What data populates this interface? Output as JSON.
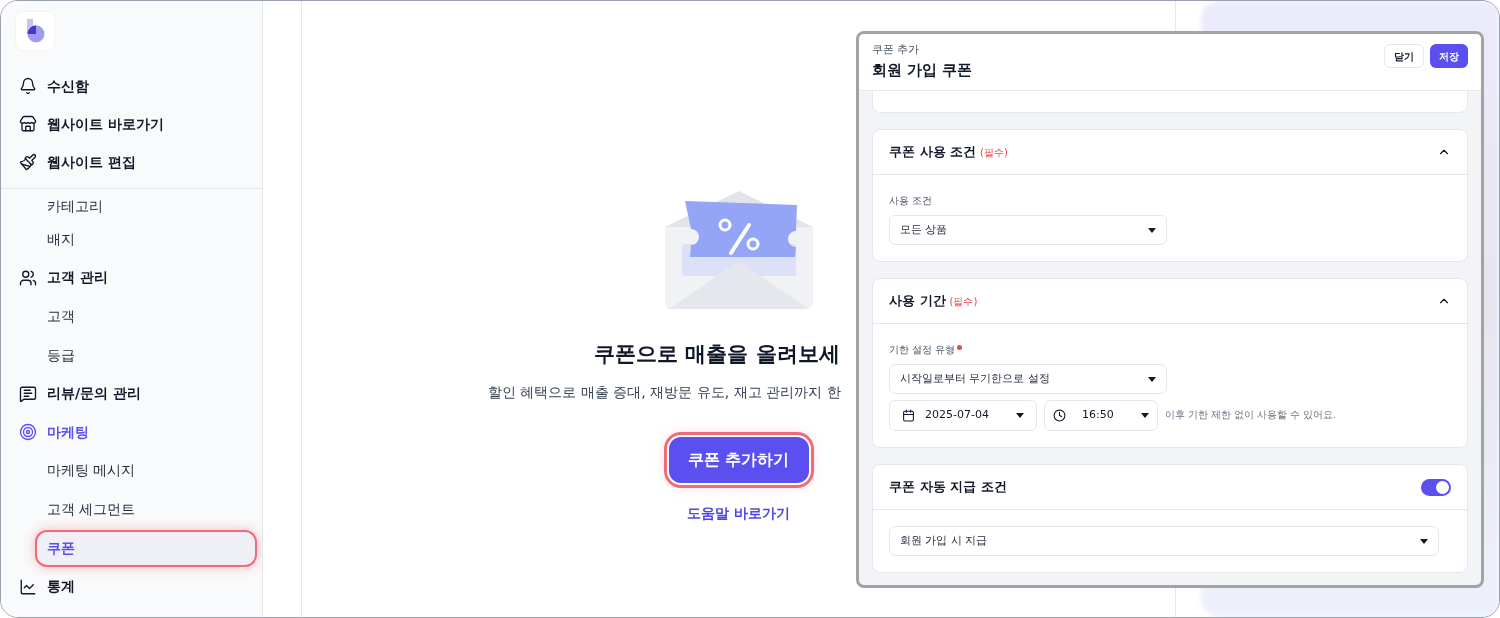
{
  "sidebar": {
    "pinned": [
      {
        "label": "수신함"
      },
      {
        "label": "웹사이트 바로가기"
      },
      {
        "label": "웹사이트 편집"
      }
    ],
    "items": [
      {
        "label": "카테고리",
        "kind": "sub",
        "selected": false,
        "highlighted": false
      },
      {
        "label": "배지",
        "kind": "sub",
        "selected": false,
        "highlighted": false
      },
      {
        "label": "고객 관리",
        "kind": "group",
        "selected": false,
        "highlighted": false
      },
      {
        "label": "고객",
        "kind": "sub",
        "selected": false,
        "highlighted": false
      },
      {
        "label": "등급",
        "kind": "sub",
        "selected": false,
        "highlighted": false
      },
      {
        "label": "리뷰/문의 관리",
        "kind": "group",
        "selected": false,
        "highlighted": false
      },
      {
        "label": "마케팅",
        "kind": "group",
        "selected": true,
        "highlighted": false
      },
      {
        "label": "마케팅 메시지",
        "kind": "sub",
        "selected": false,
        "highlighted": false
      },
      {
        "label": "고객 세그먼트",
        "kind": "sub",
        "selected": false,
        "highlighted": false
      },
      {
        "label": "쿠폰",
        "kind": "sub",
        "selected": true,
        "highlighted": true
      },
      {
        "label": "통계",
        "kind": "group",
        "selected": false,
        "highlighted": false
      }
    ]
  },
  "empty_state": {
    "title": "쿠폰으로 매출을 올려보세",
    "description": "할인 혜택으로 매출 증대, 재방문 유도, 재고 관리까지 한",
    "primary_button": {
      "label": "쿠폰 추가하기",
      "highlighted": true
    },
    "help_link": "도움말 바로가기"
  },
  "panel": {
    "subtitle": "쿠폰 추가",
    "title": "회원 가입 쿠폰",
    "buttons": [
      {
        "label": "닫기",
        "kind": "secondary"
      },
      {
        "label": "저장",
        "kind": "primary"
      }
    ],
    "sections": [
      {
        "kind": "collapsible",
        "title": "쿠폰 사용 조건",
        "badge": "(필수)",
        "expanded": true,
        "fields": [
          {
            "kind": "select",
            "label": "사용 조건",
            "required": false,
            "value": "모든 상품"
          }
        ]
      },
      {
        "kind": "collapsible",
        "title": "사용 기간",
        "badge": "(필수)",
        "expanded": true,
        "fields": [
          {
            "kind": "select",
            "label": "기한 설정 유형",
            "required": true,
            "value": "시작일로부터 무기한으로 설정"
          },
          {
            "kind": "datetime",
            "date": "2025-07-04",
            "time": "16:50",
            "hint": "이후 기한 제한 없이 사용할 수 있어요."
          }
        ]
      },
      {
        "kind": "switch",
        "title": "쿠폰 자동 지급 조건",
        "enabled": true,
        "fields": [
          {
            "kind": "select",
            "value": "회원 가입 시 지급"
          }
        ]
      }
    ]
  }
}
